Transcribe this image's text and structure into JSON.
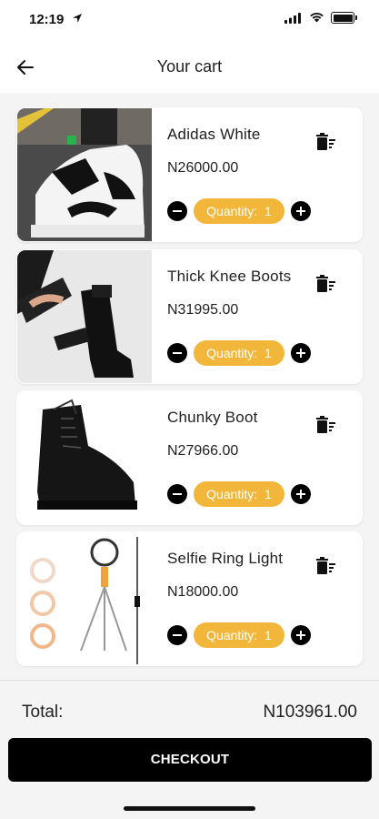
{
  "status_bar": {
    "time": "12:19"
  },
  "header": {
    "title": "Your cart"
  },
  "cart": {
    "items": [
      {
        "name": "Adidas White",
        "price": "N26000.00",
        "quantity_label": "Quantity:",
        "quantity": "1",
        "image_icon": "sneaker-image"
      },
      {
        "name": "Thick Knee Boots",
        "price": "N31995.00",
        "quantity_label": "Quantity:",
        "quantity": "1",
        "image_icon": "knee-boots-image"
      },
      {
        "name": "Chunky Boot",
        "price": "N27966.00",
        "quantity_label": "Quantity:",
        "quantity": "1",
        "image_icon": "chunky-boot-image"
      },
      {
        "name": "Selfie Ring Light",
        "price": "N18000.00",
        "quantity_label": "Quantity:",
        "quantity": "1",
        "image_icon": "ring-light-image"
      }
    ]
  },
  "summary": {
    "total_label": "Total:",
    "total_value": "N103961.00"
  },
  "checkout": {
    "label": "CHECKOUT"
  },
  "colors": {
    "accent": "#f2b73a",
    "button": "#000000",
    "background": "#f4f4f4"
  }
}
